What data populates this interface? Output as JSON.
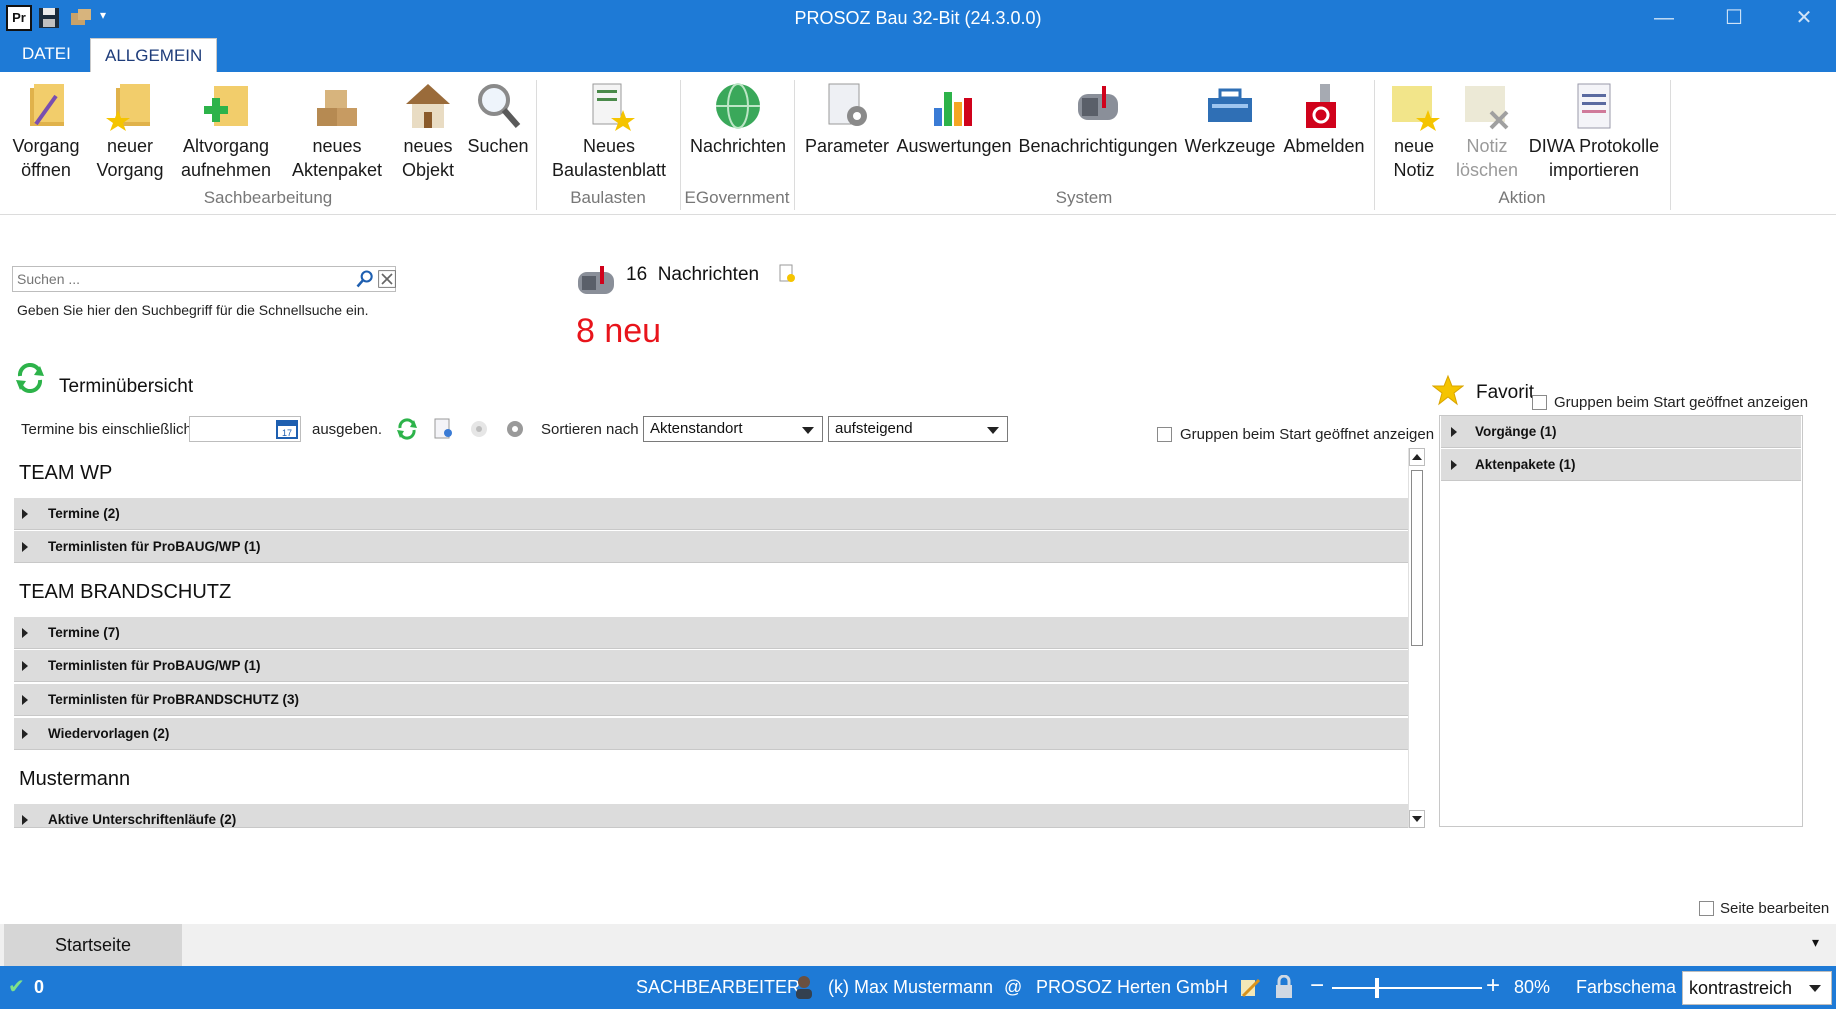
{
  "window": {
    "title": "PROSOZ Bau 32-Bit (24.3.0.0)",
    "quick_access": [
      "app-logo-icon",
      "save-icon",
      "package-icon",
      "dropdown-icon"
    ],
    "controls": [
      "minimize-icon",
      "maximize-icon",
      "close-icon"
    ],
    "app_logo_text": "Pr"
  },
  "ribbon_tabs": [
    {
      "label": "DATEI",
      "active": false
    },
    {
      "label": "ALLGEMEIN",
      "active": true
    }
  ],
  "top_search": {
    "placeholder": "Suchen ..."
  },
  "ribbon": {
    "buttons": [
      {
        "line1": "Vorgang",
        "line2": "öffnen",
        "icon": "folder-pencil-icon"
      },
      {
        "line1": "neuer",
        "line2": "Vorgang",
        "icon": "folder-star-icon"
      },
      {
        "line1": "Altvorgang",
        "line2": "aufnehmen",
        "icon": "folder-plus-icon"
      },
      {
        "line1": "neues",
        "line2": "Aktenpaket",
        "icon": "boxes-icon"
      },
      {
        "line1": "neues",
        "line2": "Objekt",
        "icon": "house-icon"
      },
      {
        "line1": "Suchen",
        "line2": "",
        "icon": "magnifier-icon"
      },
      {
        "line1": "Neues",
        "line2": "Baulastenblatt",
        "icon": "document-star-icon"
      },
      {
        "line1": "Nachrichten",
        "line2": "",
        "icon": "globe-icon"
      },
      {
        "line1": "Parameter",
        "line2": "",
        "icon": "settings-document-icon"
      },
      {
        "line1": "Auswertungen",
        "line2": "",
        "icon": "bar-chart-icon"
      },
      {
        "line1": "Benachrichtigungen",
        "line2": "",
        "icon": "mailbox-icon"
      },
      {
        "line1": "Werkzeuge",
        "line2": "",
        "icon": "toolbox-icon"
      },
      {
        "line1": "Abmelden",
        "line2": "",
        "icon": "key-logout-icon"
      },
      {
        "line1": "neue",
        "line2": "Notiz",
        "icon": "note-star-icon"
      },
      {
        "line1": "Notiz",
        "line2": "löschen",
        "icon": "note-delete-icon"
      },
      {
        "line1": "DIWA Protokolle",
        "line2": "importieren",
        "icon": "import-document-icon"
      }
    ],
    "groups": [
      "Sachbearbeitung",
      "Baulasten",
      "EGovernment",
      "System",
      "Aktion"
    ]
  },
  "quick_search": {
    "placeholder": "Suchen ...",
    "hint": "Geben Sie hier den Suchbegriff für die Schnellsuche ein."
  },
  "messages": {
    "count": "16",
    "label": "Nachrichten",
    "new_text": "8 neu"
  },
  "termin": {
    "title": "Terminübersicht",
    "until_label": "Termine bis einschließlich",
    "output_label": "ausgeben.",
    "sort_label": "Sortieren nach",
    "sort_field": "Aktenstandort",
    "sort_order": "aufsteigend",
    "open_groups_label": "Gruppen beim Start geöffnet anzeigen",
    "groups": [
      {
        "name": "TEAM WP",
        "rows": [
          "Termine (2)",
          "Terminlisten für ProBAUG/WP (1)"
        ]
      },
      {
        "name": "TEAM BRANDSCHUTZ",
        "rows": [
          "Termine (7)",
          "Terminlisten für ProBAUG/WP (1)",
          "Terminlisten für ProBRANDSCHUTZ (3)",
          "Wiedervorlagen (2)"
        ]
      },
      {
        "name": "Mustermann",
        "rows": [
          "Aktive Unterschriftenläufe (2)"
        ]
      }
    ]
  },
  "favorites": {
    "title": "Favorit",
    "open_groups_label": "Gruppen beim Start geöffnet anzeigen",
    "rows": [
      "Vorgänge (1)",
      "Aktenpakete (1)"
    ]
  },
  "page_edit_label": "Seite bearbeiten",
  "bottom_tabs": [
    {
      "label": "Startseite"
    }
  ],
  "status": {
    "check_count": "0",
    "sachbearbeiter_label": "SACHBEARBEITER:",
    "user": "(k) Max Mustermann",
    "at": "@",
    "org": "PROSOZ Herten GmbH",
    "zoom_minus": "−",
    "zoom_plus": "+",
    "zoom": "80%",
    "zoom_fraction": 0.3,
    "scheme_label": "Farbschema",
    "scheme_value": "kontrastreich"
  },
  "colors": {
    "accent": "#1e7ad6",
    "new_messages": "#e8141b",
    "row_bg": "#dcdcdc"
  }
}
